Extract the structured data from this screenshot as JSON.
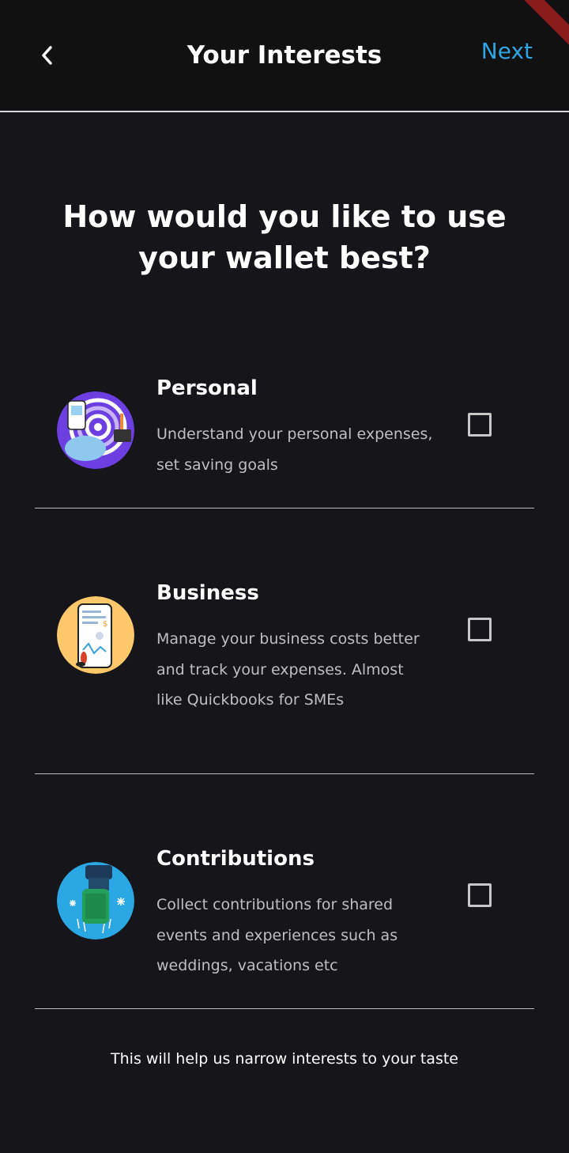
{
  "header": {
    "title": "Your Interests",
    "next_label": "Next",
    "accent_color": "#2fa6e2"
  },
  "main": {
    "headline": "How would you like to use your wallet best?",
    "options": [
      {
        "title": "Personal",
        "description": "Understand your personal expenses, set saving goals",
        "checked": false,
        "icon": "spiral-phone-illustration"
      },
      {
        "title": "Business",
        "description": "Manage your business costs better and track your expenses. Almost like Quickbooks for SMEs",
        "checked": false,
        "icon": "phone-chart-illustration"
      },
      {
        "title": "Contributions",
        "description": "Collect contributions for shared events and experiences such as weddings, vacations etc",
        "checked": false,
        "icon": "gift-fireworks-illustration"
      }
    ],
    "footer_text": "This will help us narrow interests to your taste"
  }
}
